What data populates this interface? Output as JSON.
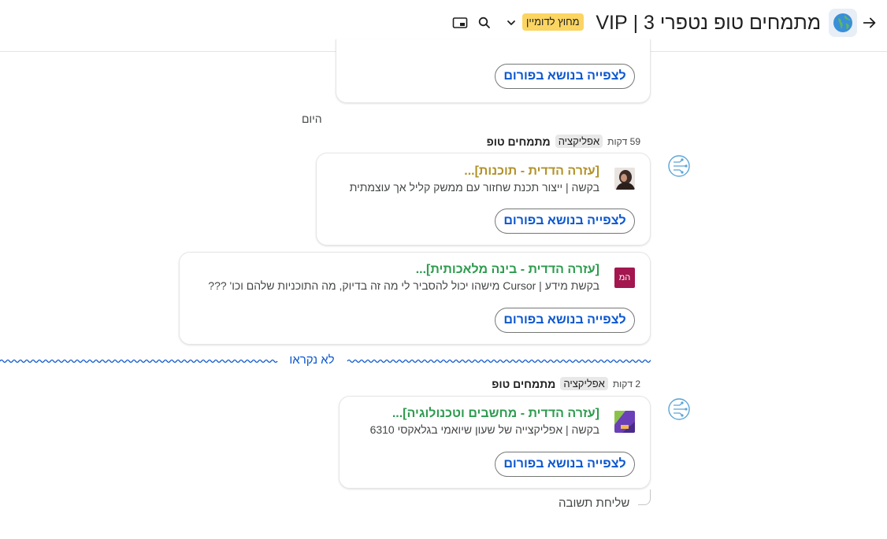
{
  "header": {
    "space_title": "מתמחים טופ נטפרי 3 | VIP",
    "external_badge": "מחוץ לדומיין",
    "icons": [
      "arrow-back-icon",
      "globe-icon",
      "chevron-down-icon",
      "search-icon",
      "picture-in-picture-icon"
    ]
  },
  "view_button_label": "לצפייה בנושא בפורום",
  "day_divider": "היום",
  "messages": [
    {
      "sender": "מתמחים טופ",
      "badge": "אפליקציה",
      "time": "59 דקות",
      "posts": [
        {
          "title": "[עזרה הדדית - תוכנות]...",
          "title_color": "#b3922a",
          "desc": "בקשה | ייצור תכנת שחזור עם ממשק קליל אך עוצמתית",
          "thumb": "photo"
        },
        {
          "title": "[עזרה הדדית - בינה מלאכותית]...",
          "title_color": "#2e9b4f",
          "desc": "בקשת מידע | Cursor מישהו יכול להסביר לי מה זה בדיוק, מה התוכניות שלהם וכו' ???",
          "thumb_text": "המ",
          "thumb_color": "#a3164f"
        }
      ]
    },
    {
      "sender": "מתמחים טופ",
      "badge": "אפליקציה",
      "time": "2 דקות",
      "posts": [
        {
          "title": "[עזרה הדדית - מחשבים וטכנולוגיה]...",
          "title_color": "#2e9b4f",
          "desc": "בקשה | אפליקצייה של שעון שיואמי בגלאקסי 6310",
          "thumb": "gradient"
        }
      ]
    }
  ],
  "unread_label": "לא נקראו",
  "reply_label": "שליחת תשובה"
}
